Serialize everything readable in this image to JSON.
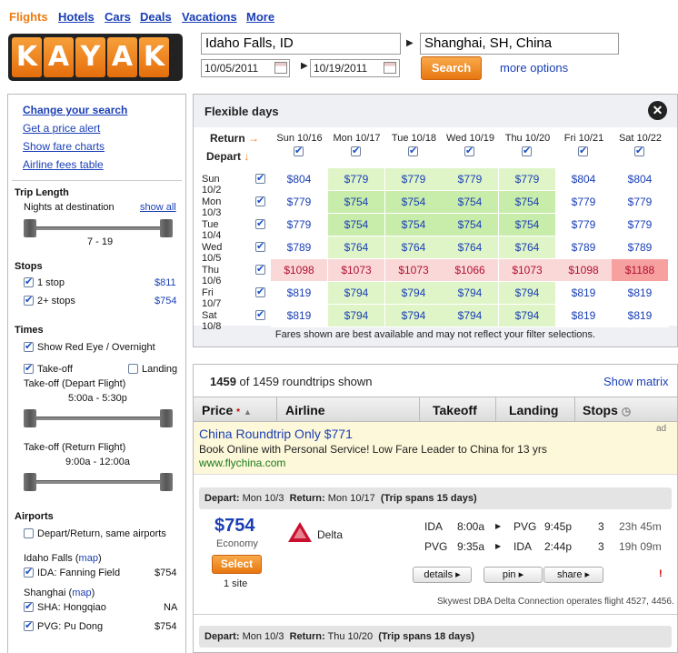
{
  "nav": [
    "Flights",
    "Hotels",
    "Cars",
    "Deals",
    "Vacations",
    "More"
  ],
  "logo": [
    "K",
    "A",
    "Y",
    "A",
    "K"
  ],
  "search": {
    "origin": "Idaho Falls, ID",
    "destination": "Shanghai, SH, China",
    "depart_date": "10/05/2011",
    "return_date": "10/19/2011",
    "button": "Search",
    "more_options": "more options"
  },
  "sidebar": {
    "links": [
      "Change your search",
      "Get a price alert",
      "Show fare charts",
      "Airline fees table"
    ],
    "trip_length": {
      "title": "Trip Length",
      "label": "Nights at destination",
      "show_all": "show all",
      "range": "7 - 19"
    },
    "stops": {
      "title": "Stops",
      "items": [
        {
          "label": "1 stop",
          "price": "$811"
        },
        {
          "label": "2+ stops",
          "price": "$754"
        }
      ]
    },
    "times": {
      "title": "Times",
      "red_eye": "Show Red Eye / Overnight",
      "takeoff": "Take-off",
      "landing": "Landing",
      "depart_label": "Take-off (Depart Flight)",
      "depart_range": "5:00a - 5:30p",
      "return_label": "Take-off (Return Flight)",
      "return_range": "9:00a - 12:00a"
    },
    "airports": {
      "title": "Airports",
      "same": "Depart/Return, same airports",
      "city1": "Idaho Falls",
      "city2": "Shanghai",
      "map": "map",
      "items": [
        {
          "label": "IDA: Fanning Field",
          "price": "$754"
        },
        {
          "label": "SHA: Hongqiao",
          "price": "NA"
        },
        {
          "label": "PVG: Pu Dong",
          "price": "$754"
        }
      ]
    }
  },
  "flex": {
    "title": "Flexible days",
    "return_label": "Return",
    "depart_label": "Depart",
    "return_dates": [
      "Sun 10/16",
      "Mon 10/17",
      "Tue 10/18",
      "Wed 10/19",
      "Thu 10/20",
      "Fri 10/21",
      "Sat 10/22"
    ],
    "depart_dates": [
      "Sun 10/2",
      "Mon 10/3",
      "Tue 10/4",
      "Wed 10/5",
      "Thu 10/6",
      "Fri 10/7",
      "Sat 10/8"
    ],
    "prices": [
      [
        "$804",
        "$779",
        "$779",
        "$779",
        "$779",
        "$804",
        "$804"
      ],
      [
        "$779",
        "$754",
        "$754",
        "$754",
        "$754",
        "$779",
        "$779"
      ],
      [
        "$779",
        "$754",
        "$754",
        "$754",
        "$754",
        "$779",
        "$779"
      ],
      [
        "$789",
        "$764",
        "$764",
        "$764",
        "$764",
        "$789",
        "$789"
      ],
      [
        "$1098",
        "$1073",
        "$1073",
        "$1066",
        "$1073",
        "$1098",
        "$1188"
      ],
      [
        "$819",
        "$794",
        "$794",
        "$794",
        "$794",
        "$819",
        "$819"
      ],
      [
        "$819",
        "$794",
        "$794",
        "$794",
        "$794",
        "$819",
        "$819"
      ]
    ],
    "note": "Fares shown are best available and may not reflect your filter selections.",
    "colors": {
      "cheap": "#dff5c8",
      "cheaper": "#c8ecaa",
      "expensive": "#fbd8d8",
      "max": "#f7a0a0"
    }
  },
  "results": {
    "count": "1459",
    "count_text": "of 1459 roundtrips shown",
    "show_matrix": "Show matrix",
    "columns": [
      "Price",
      "Airline",
      "Takeoff",
      "Landing",
      "Stops"
    ],
    "ad": {
      "title": "China Roundtrip Only $771",
      "text": "Book Online with Personal Service! Low Fare Leader to China for 13 yrs",
      "url": "www.flychina.com",
      "tag": "ad"
    },
    "trip1": {
      "depart_label": "Depart:",
      "depart": "Mon 10/3",
      "return_label": "Return:",
      "return": "Mon 10/17",
      "span": "(Trip spans 15 days)",
      "price": "$754",
      "class": "Economy",
      "select": "Select",
      "sites": "1 site",
      "airline": "Delta",
      "legs": [
        {
          "from": "IDA",
          "dep": "8:00a",
          "to": "PVG",
          "arr": "9:45p",
          "stops": "3",
          "dur": "23h 45m"
        },
        {
          "from": "PVG",
          "dep": "9:35a",
          "to": "IDA",
          "arr": "2:44p",
          "stops": "3",
          "dur": "19h 09m"
        }
      ],
      "buttons": [
        "details",
        "pin",
        "share"
      ],
      "note": "Skywest DBA Delta Connection operates flight 4527, 4456."
    },
    "trip2": {
      "depart_label": "Depart:",
      "depart": "Mon 10/3",
      "return_label": "Return:",
      "return": "Thu 10/20",
      "span": "(Trip spans 18 days)"
    }
  }
}
